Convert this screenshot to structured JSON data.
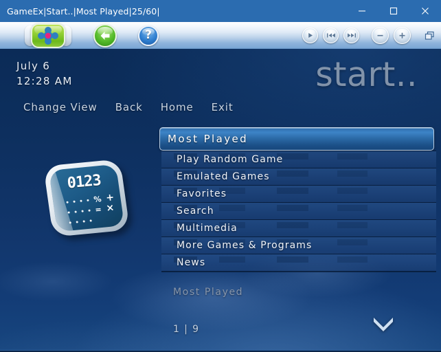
{
  "window": {
    "title": "GameEx|Start..|Most Played|25/60|",
    "controls": {
      "minimize": "minimize-button",
      "maximize": "maximize-button",
      "close": "close-button"
    }
  },
  "toolbar": {
    "home_button": "gameex-home-button",
    "back_button": "back-button",
    "help_button": "help-button",
    "help_glyph": "?",
    "play_button": "play-button",
    "prev_button": "previous-track-button",
    "next_button": "next-track-button",
    "volume_down_button": "volume-down-button",
    "volume_up_button": "volume-up-button",
    "windowed_button": "windowed-mode-button"
  },
  "header": {
    "date": "July 6",
    "time": "12:28 AM",
    "brand": "start.."
  },
  "nav": {
    "items": [
      {
        "label": "Change View"
      },
      {
        "label": "Back"
      },
      {
        "label": "Home"
      },
      {
        "label": "Exit"
      }
    ]
  },
  "icon": {
    "name": "calculator-icon",
    "display": "0123",
    "keys": [
      "%",
      "+",
      "=",
      "×"
    ]
  },
  "menu": {
    "selected": {
      "label": "Most Played"
    },
    "items": [
      {
        "label": "Play Random Game"
      },
      {
        "label": "Emulated Games"
      },
      {
        "label": "Favorites"
      },
      {
        "label": "Search"
      },
      {
        "label": "Multimedia"
      },
      {
        "label": "More Games & Programs"
      },
      {
        "label": "News"
      }
    ]
  },
  "footer": {
    "caption": "Most Played",
    "pager": "1 | 9",
    "scroll_down": "chevron-down-icon"
  },
  "colors": {
    "titlebar": "#2b6cb0",
    "stage_top": "#0b2b57",
    "stage_bottom": "#17467f",
    "selection": "#3d84c7",
    "text": "#f0f4fa",
    "accent_green": "#6cb91c",
    "accent_pink": "#e8247f"
  }
}
